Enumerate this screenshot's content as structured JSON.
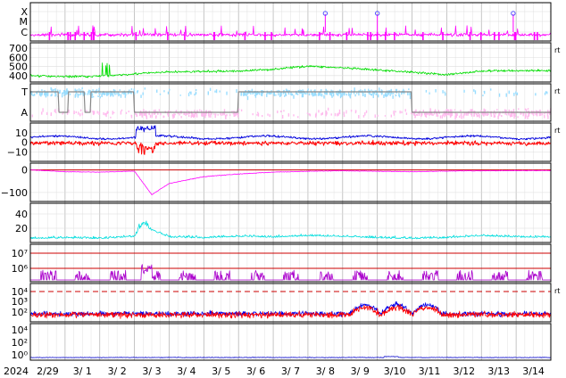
{
  "chart_data": {
    "type": "line",
    "x_axis": {
      "year_label": "2024",
      "day_labels": [
        "2/29",
        "3/ 1",
        "3/ 2",
        "3/ 3",
        "3/ 4",
        "3/ 5",
        "3/ 6",
        "3/ 7",
        "3/ 8",
        "3/ 9",
        "3/10",
        "3/11",
        "3/12",
        "3/13",
        "3/14"
      ],
      "range": [
        "2024-02-29",
        "2024-03-15"
      ],
      "grid": true
    },
    "panels": [
      {
        "id": "xray-class",
        "type": "line",
        "y_labels": [
          "X",
          "M",
          "C"
        ],
        "right_mark": "",
        "colors": {
          "line": "#ff00ff",
          "flare_marker": "#5050ff"
        },
        "flare_markers": [
          "2024-03-08T12:00",
          "2024-03-10T00:00",
          "2024-03-13T22:00"
        ]
      },
      {
        "id": "solar-wind-speed",
        "type": "line",
        "y_labels": [
          "700",
          "600",
          "500",
          "400"
        ],
        "ylim": [
          330,
          760
        ],
        "right_mark": "rt",
        "colors": {
          "line": "#00dd00"
        },
        "series": [
          {
            "x": [
              "2024-02-29",
              "2024-03-01",
              "2024-03-02",
              "2024-03-03",
              "2024-03-04",
              "2024-03-05",
              "2024-03-06",
              "2024-03-07",
              "2024-03-08",
              "2024-03-09",
              "2024-03-10",
              "2024-03-11",
              "2024-03-12",
              "2024-03-13",
              "2024-03-14"
            ],
            "y": [
              400,
              390,
              395,
              420,
              440,
              445,
              450,
              470,
              505,
              485,
              460,
              440,
              410,
              450,
              455
            ]
          }
        ]
      },
      {
        "id": "imf-sector",
        "type": "scatter",
        "y_labels": [
          "T",
          "A"
        ],
        "right_mark": "rt",
        "colors": {
          "toward": "#99ddff",
          "away": "#ffbbee",
          "state": "#888888"
        },
        "sector_state": [
          {
            "from": "2024-02-29",
            "to": "2024-03-01",
            "value": "T"
          },
          {
            "from": "2024-03-01",
            "to": "2024-03-03",
            "value": "T"
          },
          {
            "from": "2024-03-03",
            "to": "2024-03-06",
            "value": "A"
          },
          {
            "from": "2024-03-06",
            "to": "2024-03-11",
            "value": "T"
          },
          {
            "from": "2024-03-11",
            "to": "2024-03-15",
            "value": "A"
          }
        ]
      },
      {
        "id": "imf-components",
        "type": "line",
        "y_labels": [
          "10",
          "0",
          "−10"
        ],
        "ylim": [
          -20,
          20
        ],
        "right_mark": "rt",
        "colors": {
          "total": "#0000dd",
          "bz": "#ff0000"
        }
      },
      {
        "id": "dst-index",
        "type": "line",
        "y_labels": [
          "0",
          "−100"
        ],
        "ylim": [
          -140,
          30
        ],
        "right_mark": "",
        "colors": {
          "line": "#ff00ff",
          "zero": "#cc0000"
        },
        "series": [
          {
            "x": [
              "2024-02-29",
              "2024-03-01",
              "2024-03-02",
              "2024-03-03",
              "2024-03-03T12:00",
              "2024-03-04",
              "2024-03-05",
              "2024-03-06",
              "2024-03-07",
              "2024-03-08",
              "2024-03-09",
              "2024-03-10",
              "2024-03-11",
              "2024-03-12",
              "2024-03-13",
              "2024-03-14",
              "2024-03-15"
            ],
            "y": [
              0,
              -8,
              -10,
              -5,
              -110,
              -60,
              -30,
              -18,
              -10,
              -6,
              -4,
              -6,
              -8,
              -5,
              -4,
              -3,
              -3
            ]
          }
        ]
      },
      {
        "id": "proton-flux",
        "type": "line",
        "y_labels": [
          "40",
          "20"
        ],
        "ylim": [
          0,
          55
        ],
        "right_mark": "",
        "colors": {
          "line": "#00dddd"
        },
        "series": [
          {
            "x": [
              "2024-02-29",
              "2024-03-01",
              "2024-03-02",
              "2024-03-03",
              "2024-03-03T06:00",
              "2024-03-04",
              "2024-03-05",
              "2024-03-06",
              "2024-03-07",
              "2024-03-08",
              "2024-03-09",
              "2024-03-10",
              "2024-03-11",
              "2024-03-12",
              "2024-03-13",
              "2024-03-14"
            ],
            "y": [
              5,
              6,
              5,
              8,
              22,
              7,
              6,
              8,
              7,
              9,
              8,
              6,
              5,
              6,
              9,
              7
            ]
          }
        ]
      },
      {
        "id": "electron-flux",
        "type": "line",
        "y_labels": [
          "10⁷",
          "10⁶"
        ],
        "y_scale": "log",
        "right_mark": "",
        "colors": {
          "line": "#aa00cc",
          "threshold": "#cc0000"
        }
      },
      {
        "id": "xray-flux",
        "type": "line",
        "y_labels": [
          "10⁴",
          "10³",
          "10²"
        ],
        "y_scale": "log",
        "right_mark": "rt",
        "colors": {
          "short": "#0000ee",
          "long": "#ff0000",
          "threshold": "#cc0000"
        }
      },
      {
        "id": "neutron",
        "type": "line",
        "y_labels": [
          "10⁴",
          "10²",
          "10⁰"
        ],
        "y_scale": "log",
        "right_mark": "",
        "colors": {
          "line": "#0000cc"
        }
      }
    ]
  }
}
